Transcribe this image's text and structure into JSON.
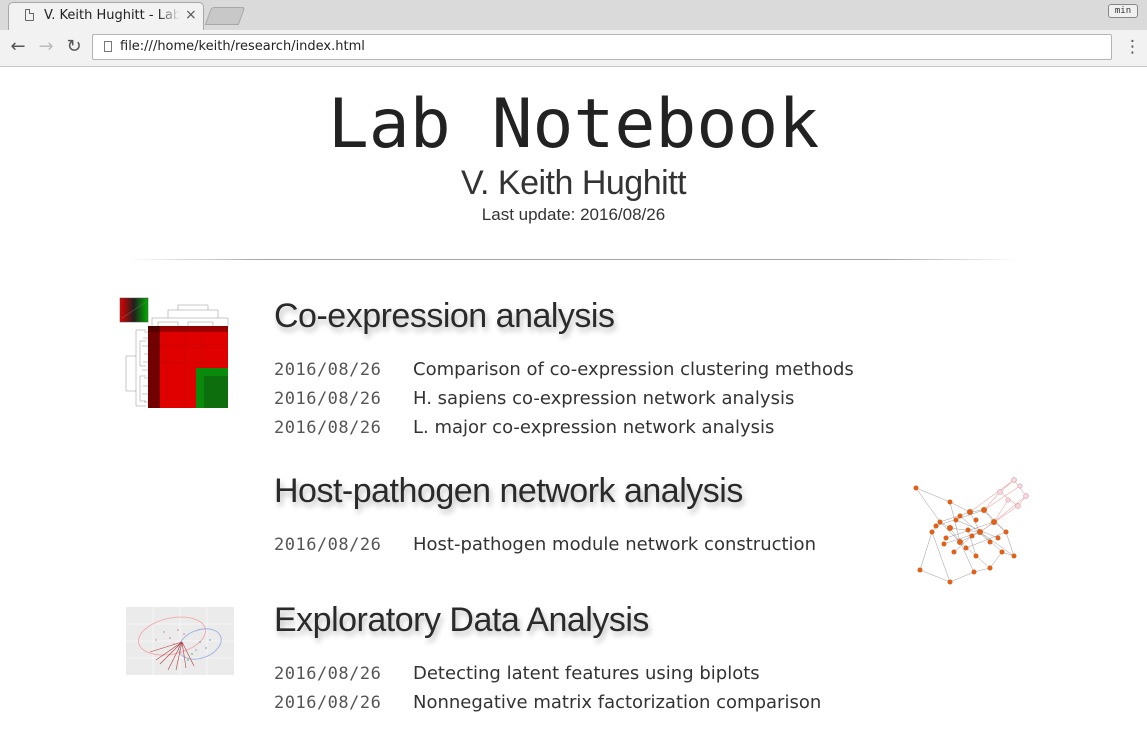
{
  "browser": {
    "tab_title": "V. Keith Hughitt - Lab Notebook",
    "tab_close": "×",
    "min_label": "min",
    "url": "file:///home/keith/research/index.html",
    "back": "←",
    "forward": "→",
    "reload": "↻",
    "menu": "⋮"
  },
  "header": {
    "title": "Lab Notebook",
    "author": "V. Keith Hughitt",
    "updated": "Last update: 2016/08/26"
  },
  "sections": [
    {
      "title": "Co-expression analysis",
      "thumbnail": "heatmap-thumbnail",
      "entries": [
        {
          "date": "2016/08/26",
          "title": "Comparison of co-expression clustering methods"
        },
        {
          "date": "2016/08/26",
          "title": "H. sapiens co-expression network analysis"
        },
        {
          "date": "2016/08/26",
          "title": "L. major co-expression network analysis"
        }
      ]
    },
    {
      "title": "Host-pathogen network analysis",
      "thumbnail": "network-thumbnail",
      "entries": [
        {
          "date": "2016/08/26",
          "title": "Host-pathogen module network construction"
        }
      ]
    },
    {
      "title": "Exploratory Data Analysis",
      "thumbnail": "biplot-thumbnail",
      "entries": [
        {
          "date": "2016/08/26",
          "title": "Detecting latent features using biplots"
        },
        {
          "date": "2016/08/26",
          "title": "Nonnegative matrix factorization comparison"
        }
      ]
    }
  ],
  "colors": {
    "heatmap_red": "#e60000",
    "heatmap_green": "#0a8a0a",
    "network_node": "#e0601a"
  }
}
